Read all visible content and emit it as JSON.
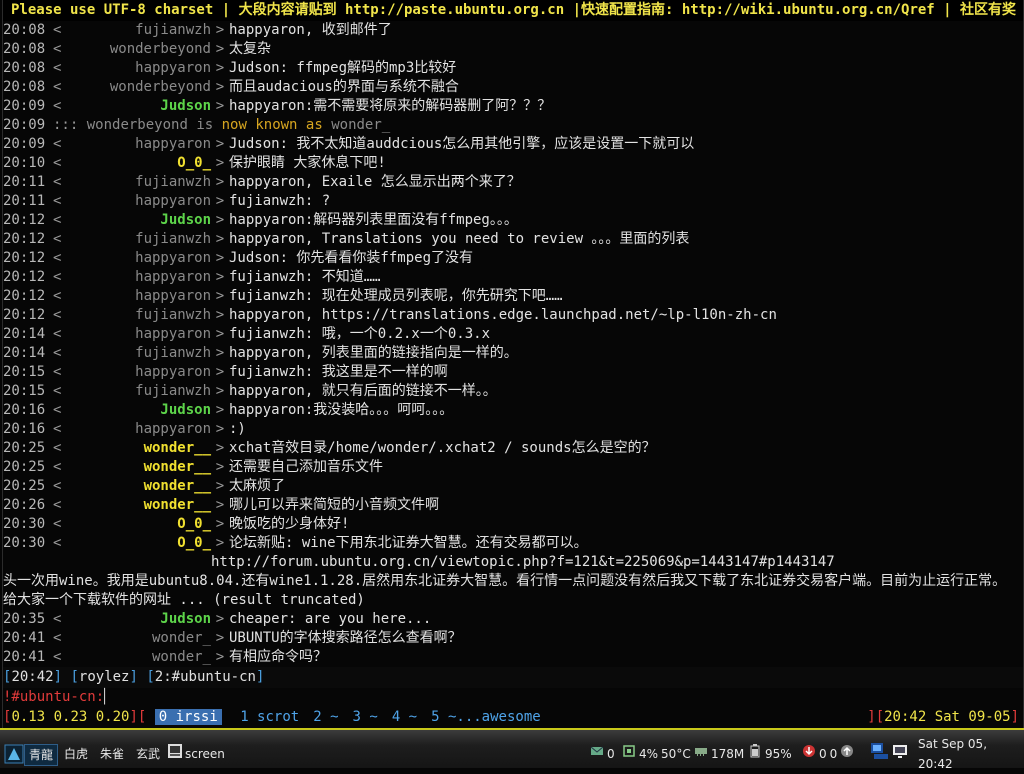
{
  "topic": "Please use UTF-8 charset | 大段内容请贴到 http://paste.ubuntu.org.cn |快速配置指南: http://wiki.ubuntu.org.cn/Qref | 社区有奖",
  "lines": [
    {
      "ts": "20:08",
      "nick": "fujianwzh",
      "style": "dim",
      "msg": "happyaron,  收到邮件了"
    },
    {
      "ts": "20:08",
      "nick": "wonderbeyond",
      "style": "dim",
      "msg": "太复杂"
    },
    {
      "ts": "20:08",
      "nick": "happyaron",
      "style": "dim",
      "msg": "Judson: ffmpeg解码的mp3比较好"
    },
    {
      "ts": "20:08",
      "nick": "wonderbeyond",
      "style": "dim",
      "msg": "而且audacious的界面与系统不融合"
    },
    {
      "ts": "20:09",
      "nick": "Judson",
      "style": "green",
      "msg": "happyaron:需不需要将原来的解码器删了阿？？？"
    }
  ],
  "nickchange": {
    "ts": "20:09",
    "prefix": ":::",
    "old": "wonderbeyond",
    "is": "is",
    "known": "now known as",
    "new": "wonder_"
  },
  "lines2": [
    {
      "ts": "20:09",
      "nick": "happyaron",
      "style": "dim",
      "msg": "Judson: 我不太知道auddcious怎么用其他引擎，应该是设置一下就可以"
    },
    {
      "ts": "20:10",
      "nick": "O_0_",
      "style": "yellow",
      "msg": "保护眼睛 大家休息下吧!"
    },
    {
      "ts": "20:11",
      "nick": "fujianwzh",
      "style": "dim",
      "msg": "happyaron,  Exaile 怎么显示出两个来了？"
    },
    {
      "ts": "20:11",
      "nick": "happyaron",
      "style": "dim",
      "msg": "fujianwzh: ?"
    },
    {
      "ts": "20:12",
      "nick": "Judson",
      "style": "green",
      "msg": "happyaron:解码器列表里面没有ffmpeg。。。"
    },
    {
      "ts": "20:12",
      "nick": "fujianwzh",
      "style": "dim",
      "msg": "happyaron,  Translations you need to review 。。。里面的列表"
    },
    {
      "ts": "20:12",
      "nick": "happyaron",
      "style": "dim",
      "msg": "Judson: 你先看看你装ffmpeg了没有"
    },
    {
      "ts": "20:12",
      "nick": "happyaron",
      "style": "dim",
      "msg": "fujianwzh: 不知道……"
    },
    {
      "ts": "20:12",
      "nick": "happyaron",
      "style": "dim",
      "msg": "fujianwzh: 现在处理成员列表呢，你先研究下吧……"
    },
    {
      "ts": "20:12",
      "nick": "fujianwzh",
      "style": "dim",
      "msg": "happyaron,  https://translations.edge.launchpad.net/~lp-l10n-zh-cn"
    },
    {
      "ts": "20:14",
      "nick": "happyaron",
      "style": "dim",
      "msg": "fujianwzh: 哦，一个0.2.x一个0.3.x"
    },
    {
      "ts": "20:14",
      "nick": "fujianwzh",
      "style": "dim",
      "msg": "happyaron,  列表里面的链接指向是一样的。"
    },
    {
      "ts": "20:15",
      "nick": "happyaron",
      "style": "dim",
      "msg": "fujianwzh: 我这里是不一样的啊"
    },
    {
      "ts": "20:15",
      "nick": "fujianwzh",
      "style": "dim",
      "msg": "happyaron,  就只有后面的链接不一样。。"
    },
    {
      "ts": "20:16",
      "nick": "Judson",
      "style": "green",
      "msg": "happyaron:我没装哈。。。呵呵。。。"
    },
    {
      "ts": "20:16",
      "nick": "happyaron",
      "style": "dim",
      "msg": ":)"
    },
    {
      "ts": "20:25",
      "nick": "wonder__",
      "style": "yellow",
      "msg": "xchat音效目录/home/wonder/.xchat2 / sounds怎么是空的？"
    },
    {
      "ts": "20:25",
      "nick": "wonder__",
      "style": "yellow",
      "msg": "还需要自己添加音乐文件"
    },
    {
      "ts": "20:25",
      "nick": "wonder__",
      "style": "yellow",
      "msg": "太麻烦了"
    },
    {
      "ts": "20:26",
      "nick": "wonder__",
      "style": "yellow",
      "msg": "哪儿可以弄来简短的小音频文件啊"
    },
    {
      "ts": "20:30",
      "nick": "O_0_",
      "style": "yellow",
      "msg": "晚饭吃的少身体好!"
    },
    {
      "ts": "20:30",
      "nick": "O_0_",
      "style": "yellow",
      "msg": "论坛新贴: wine下用东北证券大智慧。还有交易都可以。"
    }
  ],
  "continuation": "http://forum.ubuntu.org.cn/viewtopic.php?f=121&t=225069&p=1443147#p1443147",
  "wrapped": "头一次用wine。我用是ubuntu8.04.还有wine1.1.28.居然用东北证券大智慧。看行情一点问题没有然后我又下载了东北证券交易客户端。目前为止运行正常。给大家一个下载软件的网址 ... (result truncated)",
  "lines3": [
    {
      "ts": "20:35",
      "nick": "Judson",
      "style": "green",
      "msg": "cheaper: are you here..."
    },
    {
      "ts": "20:41",
      "nick": "wonder_",
      "style": "dim",
      "msg": "UBUNTU的字体搜索路径怎么查看啊？"
    },
    {
      "ts": "20:41",
      "nick": "wonder_",
      "style": "dim",
      "msg": "有相应命令吗？"
    }
  ],
  "status": {
    "time": "20:42",
    "nick": "roylez",
    "window": "2:#ubuntu-cn"
  },
  "input": {
    "prompt": "!#ubuntu-cn:"
  },
  "screen": {
    "load": "0.13 0.23 0.20",
    "active": "0 irssi",
    "windows": [
      "1 scrot",
      "2 ~",
      "3 ~",
      "4 ~",
      "5 ~...awesome"
    ],
    "right_time": "20:42 Sat 09-05"
  },
  "taskbar": {
    "workspaces": [
      "青龍",
      "白虎",
      "朱雀",
      "玄武"
    ],
    "task": "screen",
    "mail": "0",
    "cpu": "4%",
    "temp": "50°C",
    "mem": "178M",
    "battery": "95%",
    "net_down": "0",
    "net_up": "0",
    "datetime": "Sat Sep 05, 20:42"
  }
}
